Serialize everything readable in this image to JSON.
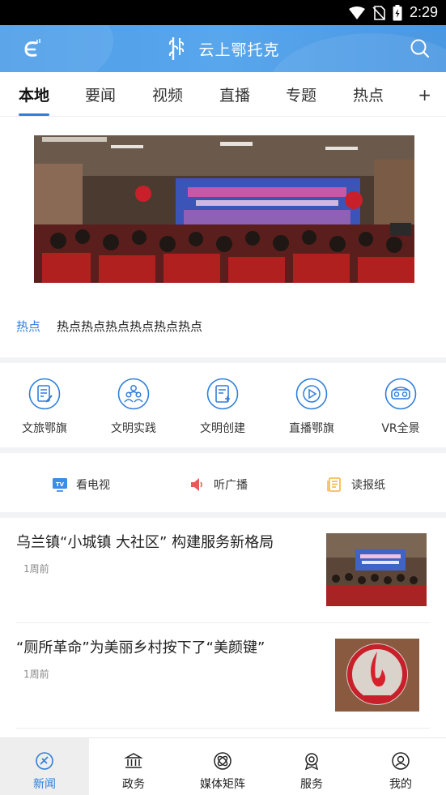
{
  "status_bar": {
    "time": "2:29"
  },
  "header": {
    "title": "云上鄂托克"
  },
  "tabs": [
    {
      "label": "本地"
    },
    {
      "label": "要闻"
    },
    {
      "label": "视频"
    },
    {
      "label": "直播"
    },
    {
      "label": "专题"
    },
    {
      "label": "热点"
    }
  ],
  "tabs_more": "+",
  "hot": {
    "tag": "热点",
    "text": "热点热点热点热点热点热点"
  },
  "quick_links": [
    {
      "label": "文旅鄂旗",
      "icon": "document-edit-icon"
    },
    {
      "label": "文明实践",
      "icon": "people-icon"
    },
    {
      "label": "文明创建",
      "icon": "clipboard-add-icon"
    },
    {
      "label": "直播鄂旗",
      "icon": "play-circle-icon"
    },
    {
      "label": "VR全景",
      "icon": "vr-goggles-icon"
    }
  ],
  "media_links": [
    {
      "label": "看电视",
      "icon": "tv-icon",
      "color": "#3a8ee6"
    },
    {
      "label": "听广播",
      "icon": "speaker-icon",
      "color": "#e85a5a"
    },
    {
      "label": "读报纸",
      "icon": "newspaper-icon",
      "color": "#f3b33d"
    }
  ],
  "news": [
    {
      "title": "乌兰镇“小城镇 大社区” 构建服务新格局",
      "time": "1周前"
    },
    {
      "title": "“厕所革命”为美丽乡村按下了“美颜键”",
      "time": "1周前"
    }
  ],
  "bottom_nav": [
    {
      "label": "新闻",
      "icon": "news-icon"
    },
    {
      "label": "政务",
      "icon": "government-icon"
    },
    {
      "label": "媒体矩阵",
      "icon": "media-matrix-icon"
    },
    {
      "label": "服务",
      "icon": "service-icon"
    },
    {
      "label": "我的",
      "icon": "profile-icon"
    }
  ],
  "colors": {
    "accent": "#2f7fdc",
    "header": "#52a1ea"
  }
}
